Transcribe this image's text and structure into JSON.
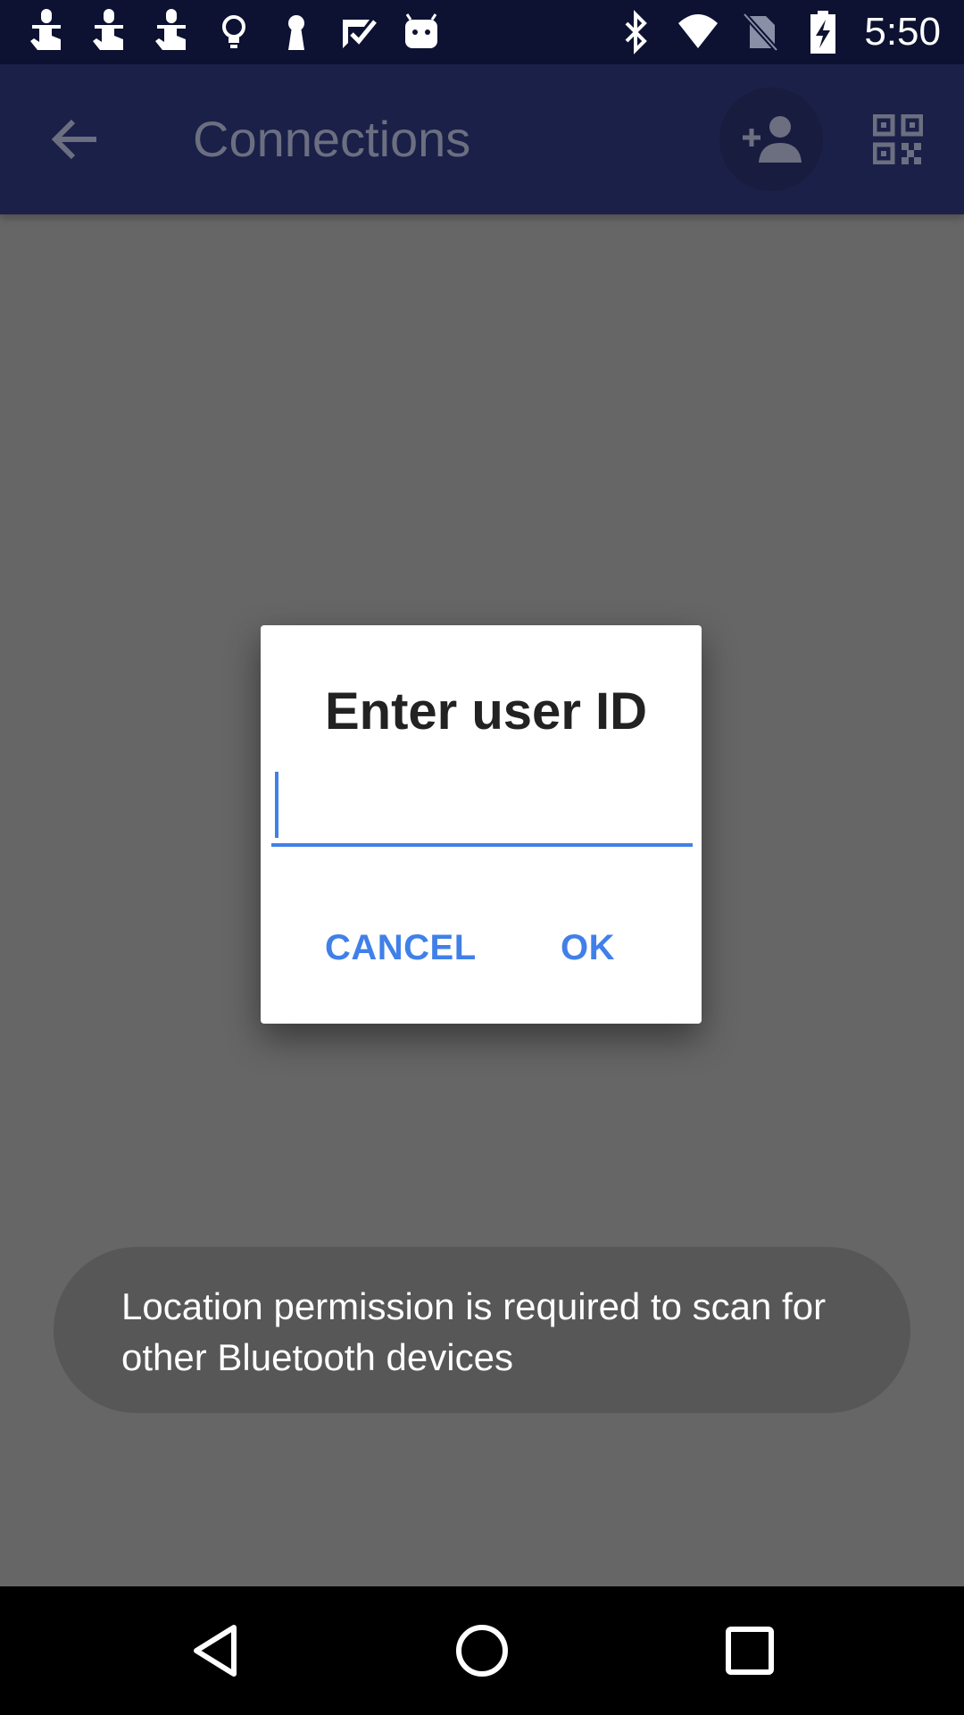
{
  "status_bar": {
    "time": "5:50",
    "left_icons": [
      "touch-icon",
      "touch-icon",
      "touch-icon",
      "lightbulb-icon",
      "keyhole-icon",
      "checkmark-app-icon",
      "android-icon"
    ],
    "right_icons": [
      "bluetooth-icon",
      "wifi-icon",
      "no-sim-icon",
      "battery-charging-icon"
    ]
  },
  "app_bar": {
    "title": "Connections",
    "actions": [
      "back-arrow-icon",
      "add-person-icon",
      "qr-code-icon"
    ]
  },
  "dialog": {
    "title": "Enter user ID",
    "input_value": "",
    "cancel_label": "CANCEL",
    "ok_label": "OK"
  },
  "toast": {
    "message": "Location permission is required to scan for other Bluetooth devices"
  },
  "nav_bar": {
    "buttons": [
      "nav-back-icon",
      "nav-home-icon",
      "nav-recents-icon"
    ]
  },
  "colors": {
    "status_bar": "#0d1232",
    "app_bar": "#1b2049",
    "scrim": "#666666",
    "accent": "#4080e8",
    "toast_bg": "#575757"
  }
}
